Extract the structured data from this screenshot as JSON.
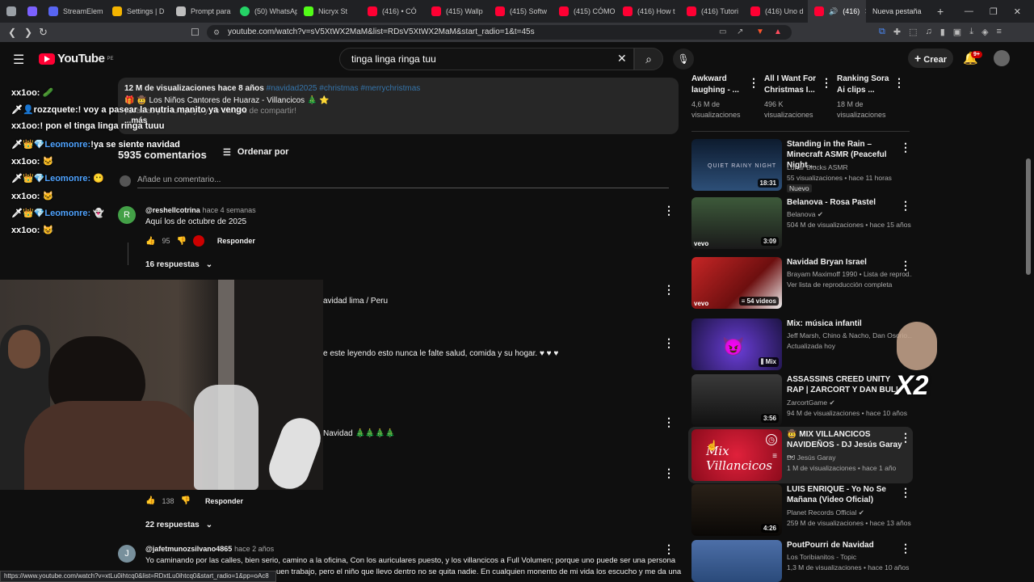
{
  "browser": {
    "tabs": [
      {
        "label": "",
        "color": "#9aa0a6"
      },
      {
        "label": "",
        "color": "#7b61ff"
      },
      {
        "label": "StreamElem",
        "color": "#5865f2"
      },
      {
        "label": "Settings | D",
        "color": "#f4b400"
      },
      {
        "label": "Prompt para",
        "color": "#bdbdbd"
      },
      {
        "label": "(50) WhatsAp",
        "color": "#25d366"
      },
      {
        "label": "Nicryx St",
        "color": "#53fc18"
      },
      {
        "label": "(416) • CÓ",
        "color": "#ff0033"
      },
      {
        "label": "(415) Wallp",
        "color": "#ff0033"
      },
      {
        "label": "(415) Softw",
        "color": "#ff0033"
      },
      {
        "label": "(415) CÓMO",
        "color": "#ff0033"
      },
      {
        "label": "(416) How t",
        "color": "#ff0033"
      },
      {
        "label": "(416) Tutori",
        "color": "#ff0033"
      },
      {
        "label": "(416) Uno d",
        "color": "#ff0033"
      }
    ],
    "active_tab": "(416)",
    "new_tab": "Nueva pestaña",
    "url": "youtube.com/watch?v=sV5XtWX2MaM&list=RDsV5XtWX2MaM&start_radio=1&t=45s",
    "status_url": "https://www.youtube.com/watch?v=xtLu0ihtcq0&list=RDxtLu0ihtcq0&start_radio=1&pp=oAc8"
  },
  "youtube": {
    "logo": "YouTube",
    "country": "PE",
    "search_value": "tinga linga ringa tuu",
    "create_label": "Crear",
    "notif_badge": "9+"
  },
  "description": {
    "stats": "12 M de visualizaciones  hace 8 años",
    "tags": "#navidad2025 #christmas #merrychristmas",
    "line2": "Los Niños Cantores de Huaraz - Villancicos",
    "line3_prefix": "¡Gracias por tu apoyo y no olvides de compartir!",
    "more": "...más"
  },
  "chat": [
    {
      "user": "xx1oo:",
      "text": "",
      "color": "#ffffff"
    },
    {
      "user": "rozzquete:",
      "text": "! voy a pasear la nutria manito ya vengo",
      "color": "#ffffff"
    },
    {
      "user": "xx1oo:",
      "text": "! pon el tinga linga ringa tuuu",
      "color": "#ffffff"
    },
    {
      "user": "Leomonre:",
      "text": "!ya se siente navidad",
      "color": "#4fa3ff"
    },
    {
      "user": "xx1oo:",
      "text": "",
      "color": "#ffffff"
    },
    {
      "user": "Leomonre:",
      "text": "",
      "color": "#4fa3ff"
    },
    {
      "user": "xx1oo:",
      "text": "",
      "color": "#ffffff"
    },
    {
      "user": "Leomonre:",
      "text": "",
      "color": "#4fa3ff"
    },
    {
      "user": "xx1oo:",
      "text": "",
      "color": "#ffffff"
    }
  ],
  "comments": {
    "count": "5935 comentarios",
    "sort": "Ordenar por",
    "add_placeholder": "Añade un comentario...",
    "c1": {
      "handle": "@reshellcotrina",
      "time": "hace 4 semanas",
      "text": "Aquí los de octubre de 2025",
      "likes": "95",
      "reply": "Responder",
      "replies": "16 respuestas"
    },
    "c2_text": "avidad lima / Peru",
    "c3_text": "e este leyendo esto nunca le falte salud, comida y su hogar. ♥ ♥ ♥",
    "c4_text": "Navidad 🎄🎄🎄🎄",
    "c5": {
      "likes": "138",
      "reply": "Responder",
      "replies": "22 respuestas"
    },
    "c6": {
      "handle": "@jafetmunozsilvano4865",
      "time": "hace 2 años",
      "text1": "Yo caminando por las calles, bien serio, camino a la oficina, Con los auriculares puesto,  y los villancicos a Full Volumen; porque uno puede ser una persona",
      "text2": "uen trabajo, pero el niño que llevo dentro no se quita nadie. En cualquien monento de mi vida los escucho y me da una"
    }
  },
  "top_related": [
    {
      "title": "Awkward laughing - ...",
      "meta": "4,6 M de visualizaciones"
    },
    {
      "title": "All I Want For Christmas I...",
      "meta": "496 K visualizaciones"
    },
    {
      "title": "Ranking Sora Ai clips ...",
      "meta": "18 M de visualizaciones"
    }
  ],
  "related": [
    {
      "title": "Standing in the Rain – Minecraft ASMR (Peaceful Night ...",
      "channel": "Lunar Blocks ASMR",
      "meta": "55 visualizaciones • hace 11 horas",
      "extra": "Nuevo",
      "duration": "18:31",
      "thumb_color": "#1d3350"
    },
    {
      "title": "Belanova - Rosa Pastel",
      "channel": "Belanova",
      "meta": "504 M de visualizaciones • hace 15 años",
      "extra": "",
      "duration": "3:09",
      "thumb_color": "#2d3a2a"
    },
    {
      "title": "Navidad Bryan Israel",
      "channel": "Brayam Maximoff 1990 • Lista de reprod...",
      "meta": "Ver lista de reproducción completa",
      "extra": "",
      "duration": "54 videos",
      "thumb_color": "#8a1e1e"
    },
    {
      "title": "Mix: música infantil",
      "channel": "Jeff Marsh, Chino & Nacho, Dan Osorio...",
      "meta": "Actualizada hoy",
      "extra": "",
      "duration": "Mix",
      "thumb_color": "#3a2a8a"
    },
    {
      "title": "ASSASSINS CREED UNITY RAP | ZARCORT Y DAN BULL",
      "channel": "ZarcortGame",
      "meta": "94 M de visualizaciones • hace 10 años",
      "extra": "",
      "duration": "3:56",
      "thumb_color": "#2b2b2b"
    },
    {
      "title": "MIX VILLANCICOS NAVIDEÑOS - DJ Jesús Garay ...",
      "channel": "DJ Jesús Garay",
      "meta": "1 M de visualizaciones • hace 1 año",
      "extra": "",
      "duration": "",
      "thumb_color": "#c4102a"
    },
    {
      "title": "LUIS ENRIQUE - Yo No Se Mañana (Video Oficial)",
      "channel": "Planet Records Official",
      "meta": "259 M de visualizaciones • hace 13 años",
      "extra": "",
      "duration": "4:26",
      "thumb_color": "#20180f"
    },
    {
      "title": "PoutPourri de Navidad",
      "channel": "Los Toribianitos - Topic",
      "meta": "1,3 M de visualizaciones • hace 10 años",
      "extra": "",
      "duration": "",
      "thumb_color": "#3a5a8a"
    }
  ],
  "overlay": {
    "x2": "X2"
  },
  "colors": {
    "bg": "#0f0f0f",
    "accent": "#ff0033",
    "surface": "#272727"
  }
}
